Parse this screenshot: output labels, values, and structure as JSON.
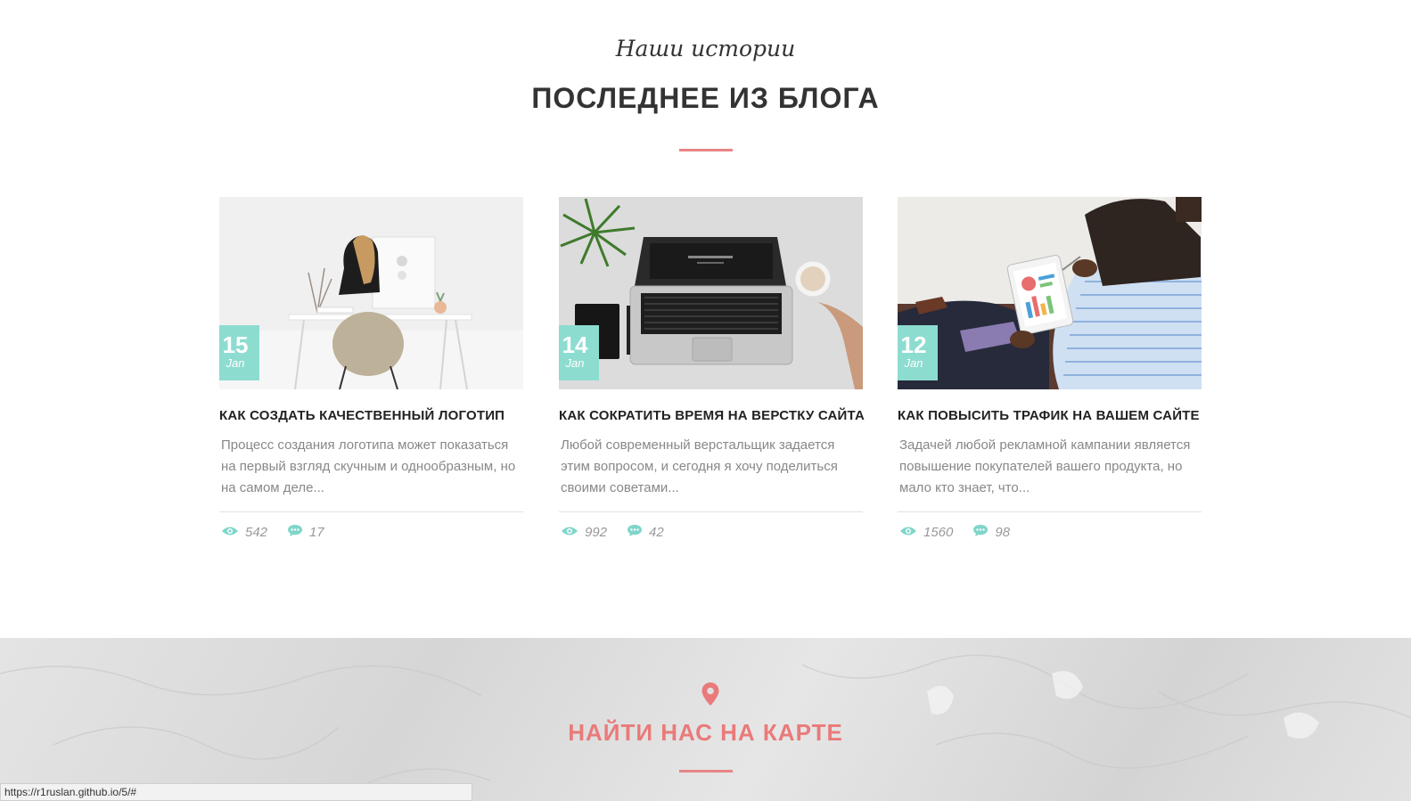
{
  "blog": {
    "subtitle": "Наши истории",
    "title": "ПОСЛЕДНЕЕ ИЗ БЛОГА",
    "posts": [
      {
        "day": "15",
        "month": "Jan",
        "title": "КАК СОЗДАТЬ КАЧЕСТВЕННЫЙ ЛОГОТИП",
        "excerpt": "Процесс создания логотипа может показаться на первый взгляд скучным и однообразным, но на самом деле...",
        "views": "542",
        "comments": "17"
      },
      {
        "day": "14",
        "month": "Jan",
        "title": "КАК СОКРАТИТЬ ВРЕМЯ НА ВЕРСТКУ САЙТА",
        "excerpt": "Любой современный верстальщик задается этим вопросом, и сегодня я хочу поделиться своими советами...",
        "views": "992",
        "comments": "42"
      },
      {
        "day": "12",
        "month": "Jan",
        "title": "КАК ПОВЫСИТЬ ТРАФИК НА ВАШЕМ САЙТЕ",
        "excerpt": "Задачей любой рекламной кампании является повышение покупателей вашего продукта, но мало кто знает, что...",
        "views": "1560",
        "comments": "98"
      }
    ]
  },
  "map": {
    "title": "НАЙТИ НАС НА КАРТЕ"
  },
  "status_bar": {
    "url": "https://r1ruslan.github.io/5/#"
  },
  "colors": {
    "accent": "#e88585",
    "date_badge": "#8ddcd0",
    "icon": "#7fd6c9"
  }
}
